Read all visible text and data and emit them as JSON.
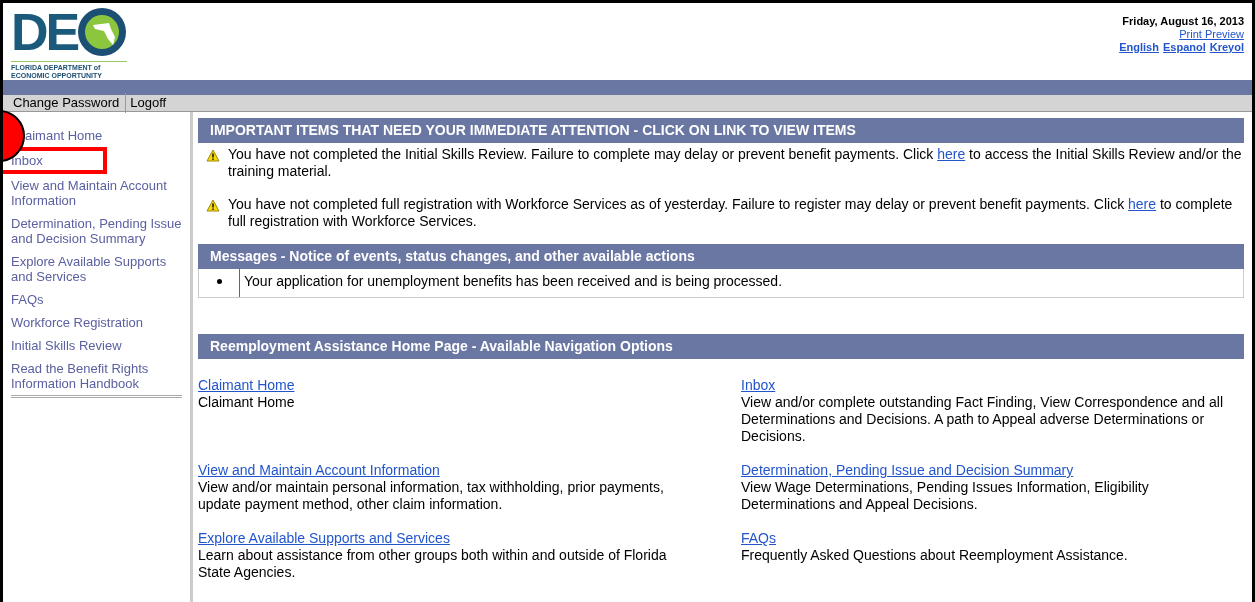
{
  "logo": {
    "letters": "DE",
    "caption_lines": [
      "FLORIDA DEPARTMENT of",
      "ECONOMIC OPPORTUNITY"
    ]
  },
  "header": {
    "date": "Friday, August 16, 2013",
    "print_link": "Print Preview",
    "languages": [
      "English",
      "Espanol",
      "Kreyol"
    ]
  },
  "toolbar": [
    "Change Password",
    "Logoff"
  ],
  "sidebar": {
    "items": [
      {
        "label": "aimant Home",
        "highlighted": false
      },
      {
        "label": "Inbox",
        "highlighted": true
      },
      {
        "label": "View and Maintain Account Information",
        "highlighted": false
      },
      {
        "label": "Determination, Pending Issue and Decision Summary",
        "highlighted": false
      },
      {
        "label": "Explore Available Supports and Services",
        "highlighted": false
      },
      {
        "label": "FAQs",
        "highlighted": false
      },
      {
        "label": "Workforce Registration",
        "highlighted": false
      },
      {
        "label": "Initial Skills Review",
        "highlighted": false
      },
      {
        "label": "Read the Benefit Rights Information Handbook",
        "highlighted": false
      }
    ]
  },
  "important": {
    "title": "IMPORTANT ITEMS THAT NEED YOUR IMMEDIATE ATTENTION - CLICK ON LINK TO VIEW ITEMS",
    "items": [
      {
        "before": "You have not completed the Initial Skills Review. Failure to complete may delay or prevent benefit payments. Click",
        "link": "here",
        "after": "to access the Initial Skills Review and/or the training material."
      },
      {
        "before": "You have not completed full registration with Workforce Services as of yesterday. Failure to register may delay or prevent benefit payments. Click",
        "link": "here",
        "after": "to complete full registration with Workforce Services."
      }
    ]
  },
  "messages": {
    "title": "Messages - Notice of events, status changes, and other available actions",
    "items": [
      "Your application for unemployment benefits has been received and is being processed."
    ]
  },
  "navigation": {
    "title": "Reemployment Assistance Home Page - Available Navigation Options",
    "options": [
      {
        "link": "Claimant Home",
        "description": "Claimant Home"
      },
      {
        "link": "Inbox",
        "description": "View and/or complete outstanding Fact Finding, View Correspondence and all Determinations and Decisions. A path to Appeal adverse Determinations or Decisions."
      },
      {
        "link": "View and Maintain Account Information",
        "description": "View and/or maintain personal information, tax withholding, prior payments, update payment method, other claim information."
      },
      {
        "link": "Determination, Pending Issue and Decision Summary",
        "description": "View Wage Determinations, Pending Issues Information, Eligibility Determinations and Appeal Decisions."
      },
      {
        "link": "Explore Available Supports and Services",
        "description": "Learn about assistance from other groups both within and outside of Florida State Agencies."
      },
      {
        "link": "FAQs",
        "description": "Frequently Asked Questions about Reemployment Assistance."
      }
    ]
  }
}
